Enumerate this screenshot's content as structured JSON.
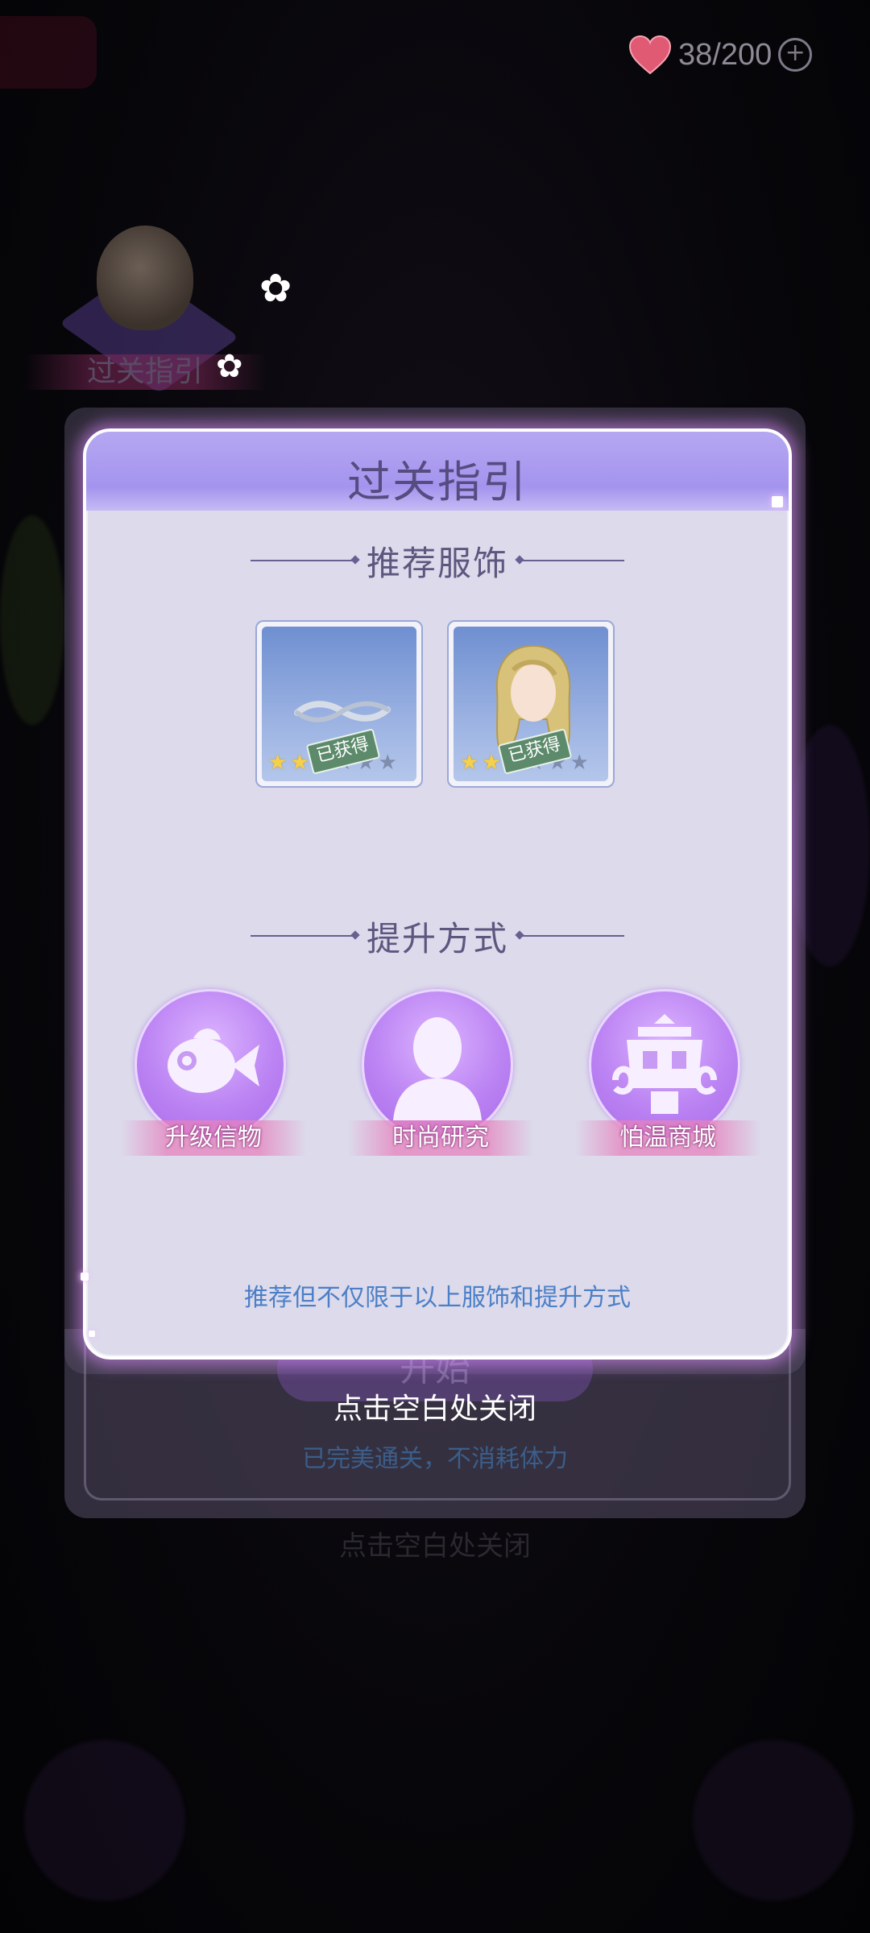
{
  "background": {
    "guide_label": "过关指引",
    "start_button": "开始",
    "ghost_close_hint": "点击空白处关闭"
  },
  "stamina": {
    "value": "38/200",
    "heart_color": "#ff4a6b",
    "plus_icon": "plus-icon"
  },
  "modal": {
    "title": "过关指引",
    "recommended_section": "推荐服饰",
    "items": [
      {
        "icon": "tiara-icon",
        "stars_on": 2,
        "stars_total": 6,
        "badge": "已获得"
      },
      {
        "icon": "hair-icon",
        "stars_on": 2,
        "stars_total": 6,
        "badge": "已获得"
      }
    ],
    "improve_section": "提升方式",
    "ways": [
      {
        "icon": "fish-icon",
        "label": "升级信物"
      },
      {
        "icon": "person-icon",
        "label": "时尚研究"
      },
      {
        "icon": "shop-icon",
        "label": "怕温商城"
      }
    ],
    "footnote": "推荐但不仅限于以上服饰和提升方式"
  },
  "close_hint": "点击空白处关闭",
  "perfect_note": "已完美通关，不消耗体力"
}
